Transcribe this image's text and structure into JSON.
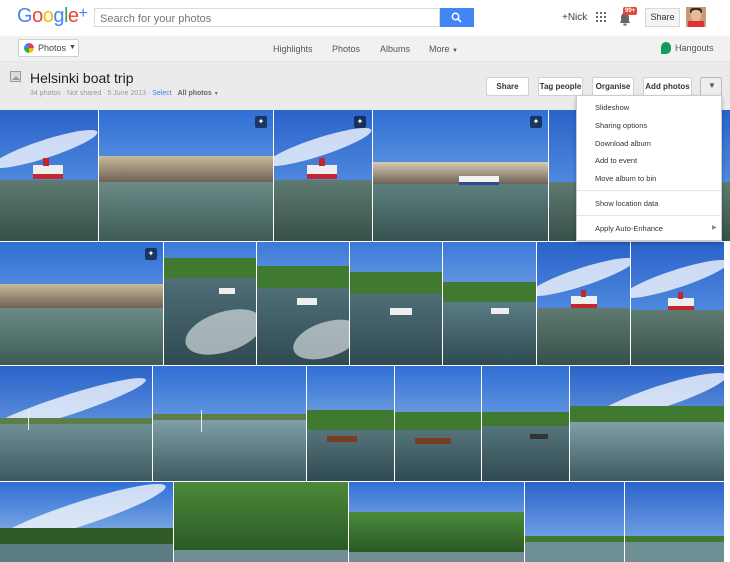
{
  "header": {
    "logo_text": "Google+",
    "search_placeholder": "Search for your photos",
    "user_link": "+Nick",
    "notification_count": "99+",
    "share_label": "Share"
  },
  "subnav": {
    "app_switcher_label": "Photos",
    "items": [
      "Highlights",
      "Photos",
      "Albums",
      "More"
    ],
    "hangouts_label": "Hangouts"
  },
  "album": {
    "title": "Helsinki boat trip",
    "photo_count": "34 photos",
    "sharing": "Not shared",
    "date": "5 June 2013",
    "select_label": "Select",
    "filter_label": "All photos",
    "buttons": {
      "share": "Share",
      "tag_people": "Tag people",
      "organise": "Organise",
      "add_photos": "Add photos"
    }
  },
  "menu": {
    "items": [
      "Slideshow",
      "Sharing options",
      "Download album",
      "Add to event",
      "Move album to bin"
    ],
    "location": "Show location data",
    "auto_enhance": "Apply Auto-Enhance"
  },
  "colors": {
    "accent_blue": "#4285f4",
    "notification_red": "#dd4b39",
    "hangouts_green": "#0f9d58",
    "link_blue": "#427fed"
  },
  "icons": [
    "search-icon",
    "apps-grid-icon",
    "bell-icon",
    "photos-pinwheel-icon",
    "hangouts-icon",
    "album-icon",
    "chevron-down-icon",
    "auto-enhance-icon",
    "submenu-arrow-icon"
  ]
}
